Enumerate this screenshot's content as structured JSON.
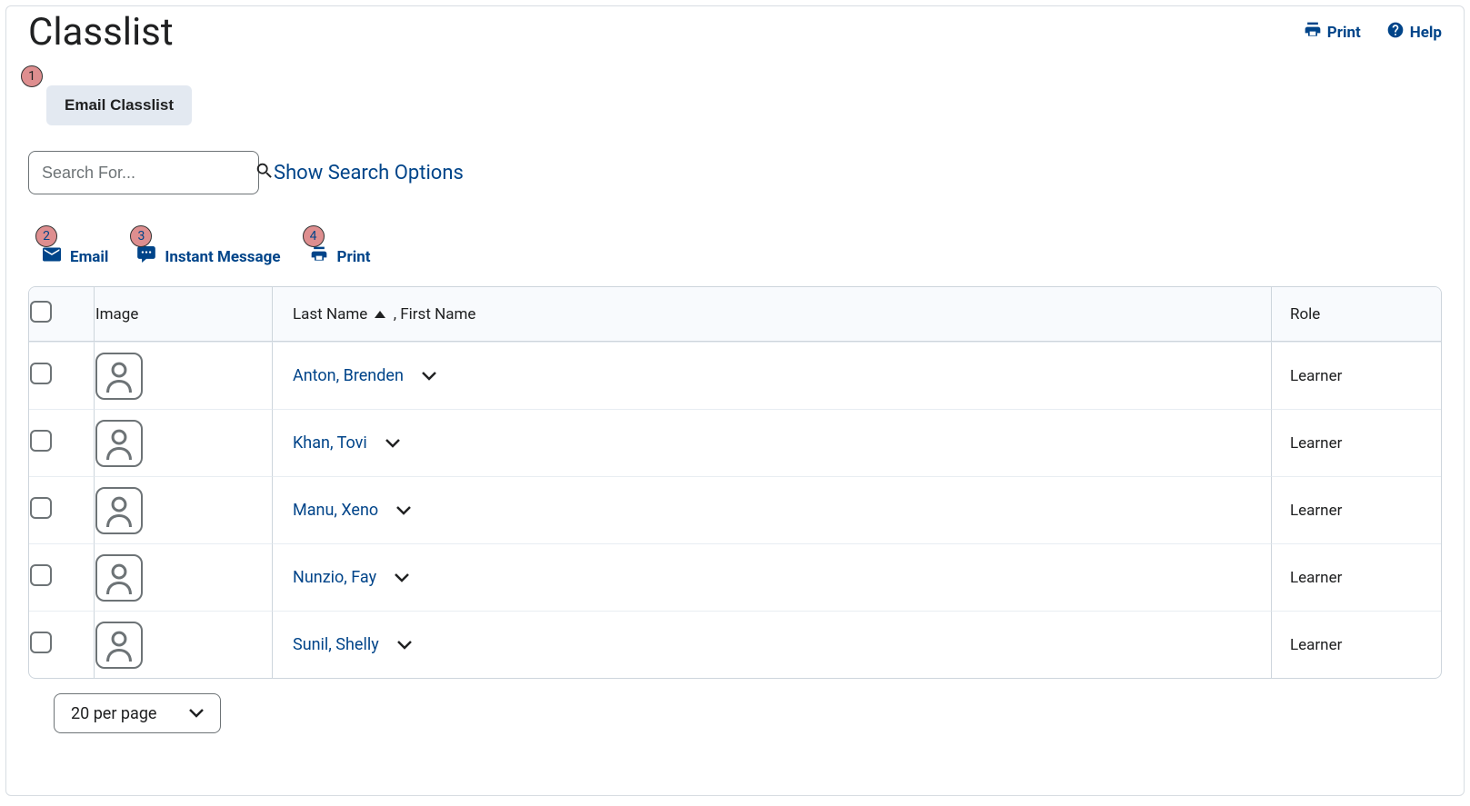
{
  "header": {
    "title": "Classlist",
    "print": "Print",
    "help": "Help"
  },
  "buttons": {
    "email_classlist": "Email Classlist"
  },
  "search": {
    "placeholder": "Search For...",
    "options_link": "Show Search Options"
  },
  "actions": {
    "email": "Email",
    "instant_message": "Instant Message",
    "print": "Print"
  },
  "callouts": {
    "c1": "1",
    "c2": "2",
    "c3": "3",
    "c4": "4"
  },
  "table": {
    "headers": {
      "image": "Image",
      "last_name": "Last Name",
      "first_name": "First Name",
      "role": "Role"
    },
    "rows": [
      {
        "name": "Anton, Brenden",
        "role": "Learner"
      },
      {
        "name": "Khan, Tovi",
        "role": "Learner"
      },
      {
        "name": "Manu, Xeno",
        "role": "Learner"
      },
      {
        "name": "Nunzio, Fay",
        "role": "Learner"
      },
      {
        "name": "Sunil, Shelly",
        "role": "Learner"
      }
    ]
  },
  "pager": {
    "per_page": "20 per page"
  }
}
